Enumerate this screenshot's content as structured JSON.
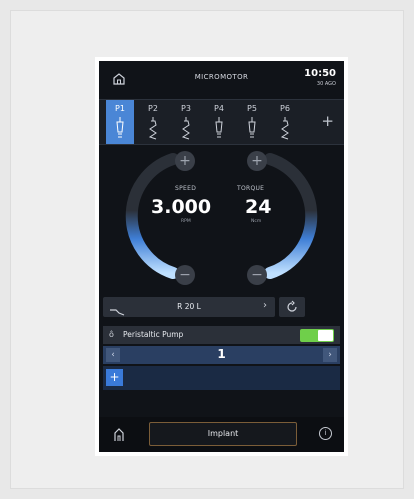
{
  "header": {
    "title": "MICROMOTOR",
    "time": "10:50",
    "date": "30 AGO"
  },
  "programs": {
    "items": [
      {
        "label": "P1",
        "active": true
      },
      {
        "label": "P2",
        "active": false
      },
      {
        "label": "P3",
        "active": false
      },
      {
        "label": "P4",
        "active": false
      },
      {
        "label": "P5",
        "active": false
      },
      {
        "label": "P6",
        "active": false
      }
    ],
    "add_label": "+"
  },
  "speed": {
    "label": "SPEED",
    "value": "3.000",
    "unit": "RPM",
    "plus": "+",
    "minus": "−"
  },
  "torque": {
    "label": "TORQUE",
    "value": "24",
    "unit": "Ncm",
    "plus": "+",
    "minus": "−"
  },
  "handpiece": {
    "name": "R 20 L",
    "chevron": "›"
  },
  "pump": {
    "label": "Peristaltic Pump",
    "icon": "ô",
    "enabled": true
  },
  "flow": {
    "value": "1",
    "prev": "‹",
    "next": "›"
  },
  "add_button": "+",
  "bottom": {
    "mode": "Implant",
    "info": "i"
  },
  "colors": {
    "accent": "#4a86d6",
    "toggle_on": "#6fcf4a",
    "background": "#101318"
  }
}
